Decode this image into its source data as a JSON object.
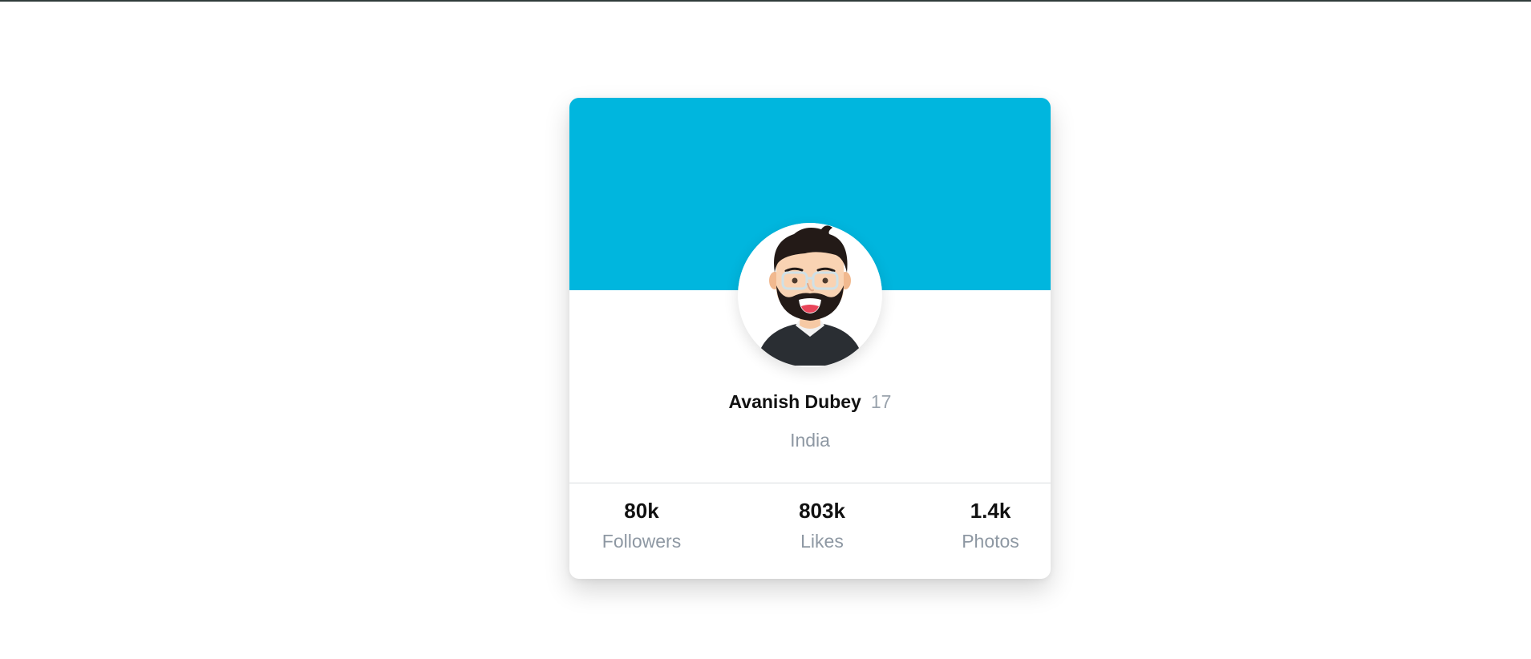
{
  "profile": {
    "name": "Avanish Dubey",
    "age": "17",
    "country": "India",
    "avatar_icon": "bearded-man-avatar"
  },
  "stats": [
    {
      "value": "80k",
      "label": "Followers"
    },
    {
      "value": "803k",
      "label": "Likes"
    },
    {
      "value": "1.4k",
      "label": "Photos"
    }
  ],
  "colors": {
    "banner": "#00b6de",
    "muted_text": "#8e98a3"
  }
}
